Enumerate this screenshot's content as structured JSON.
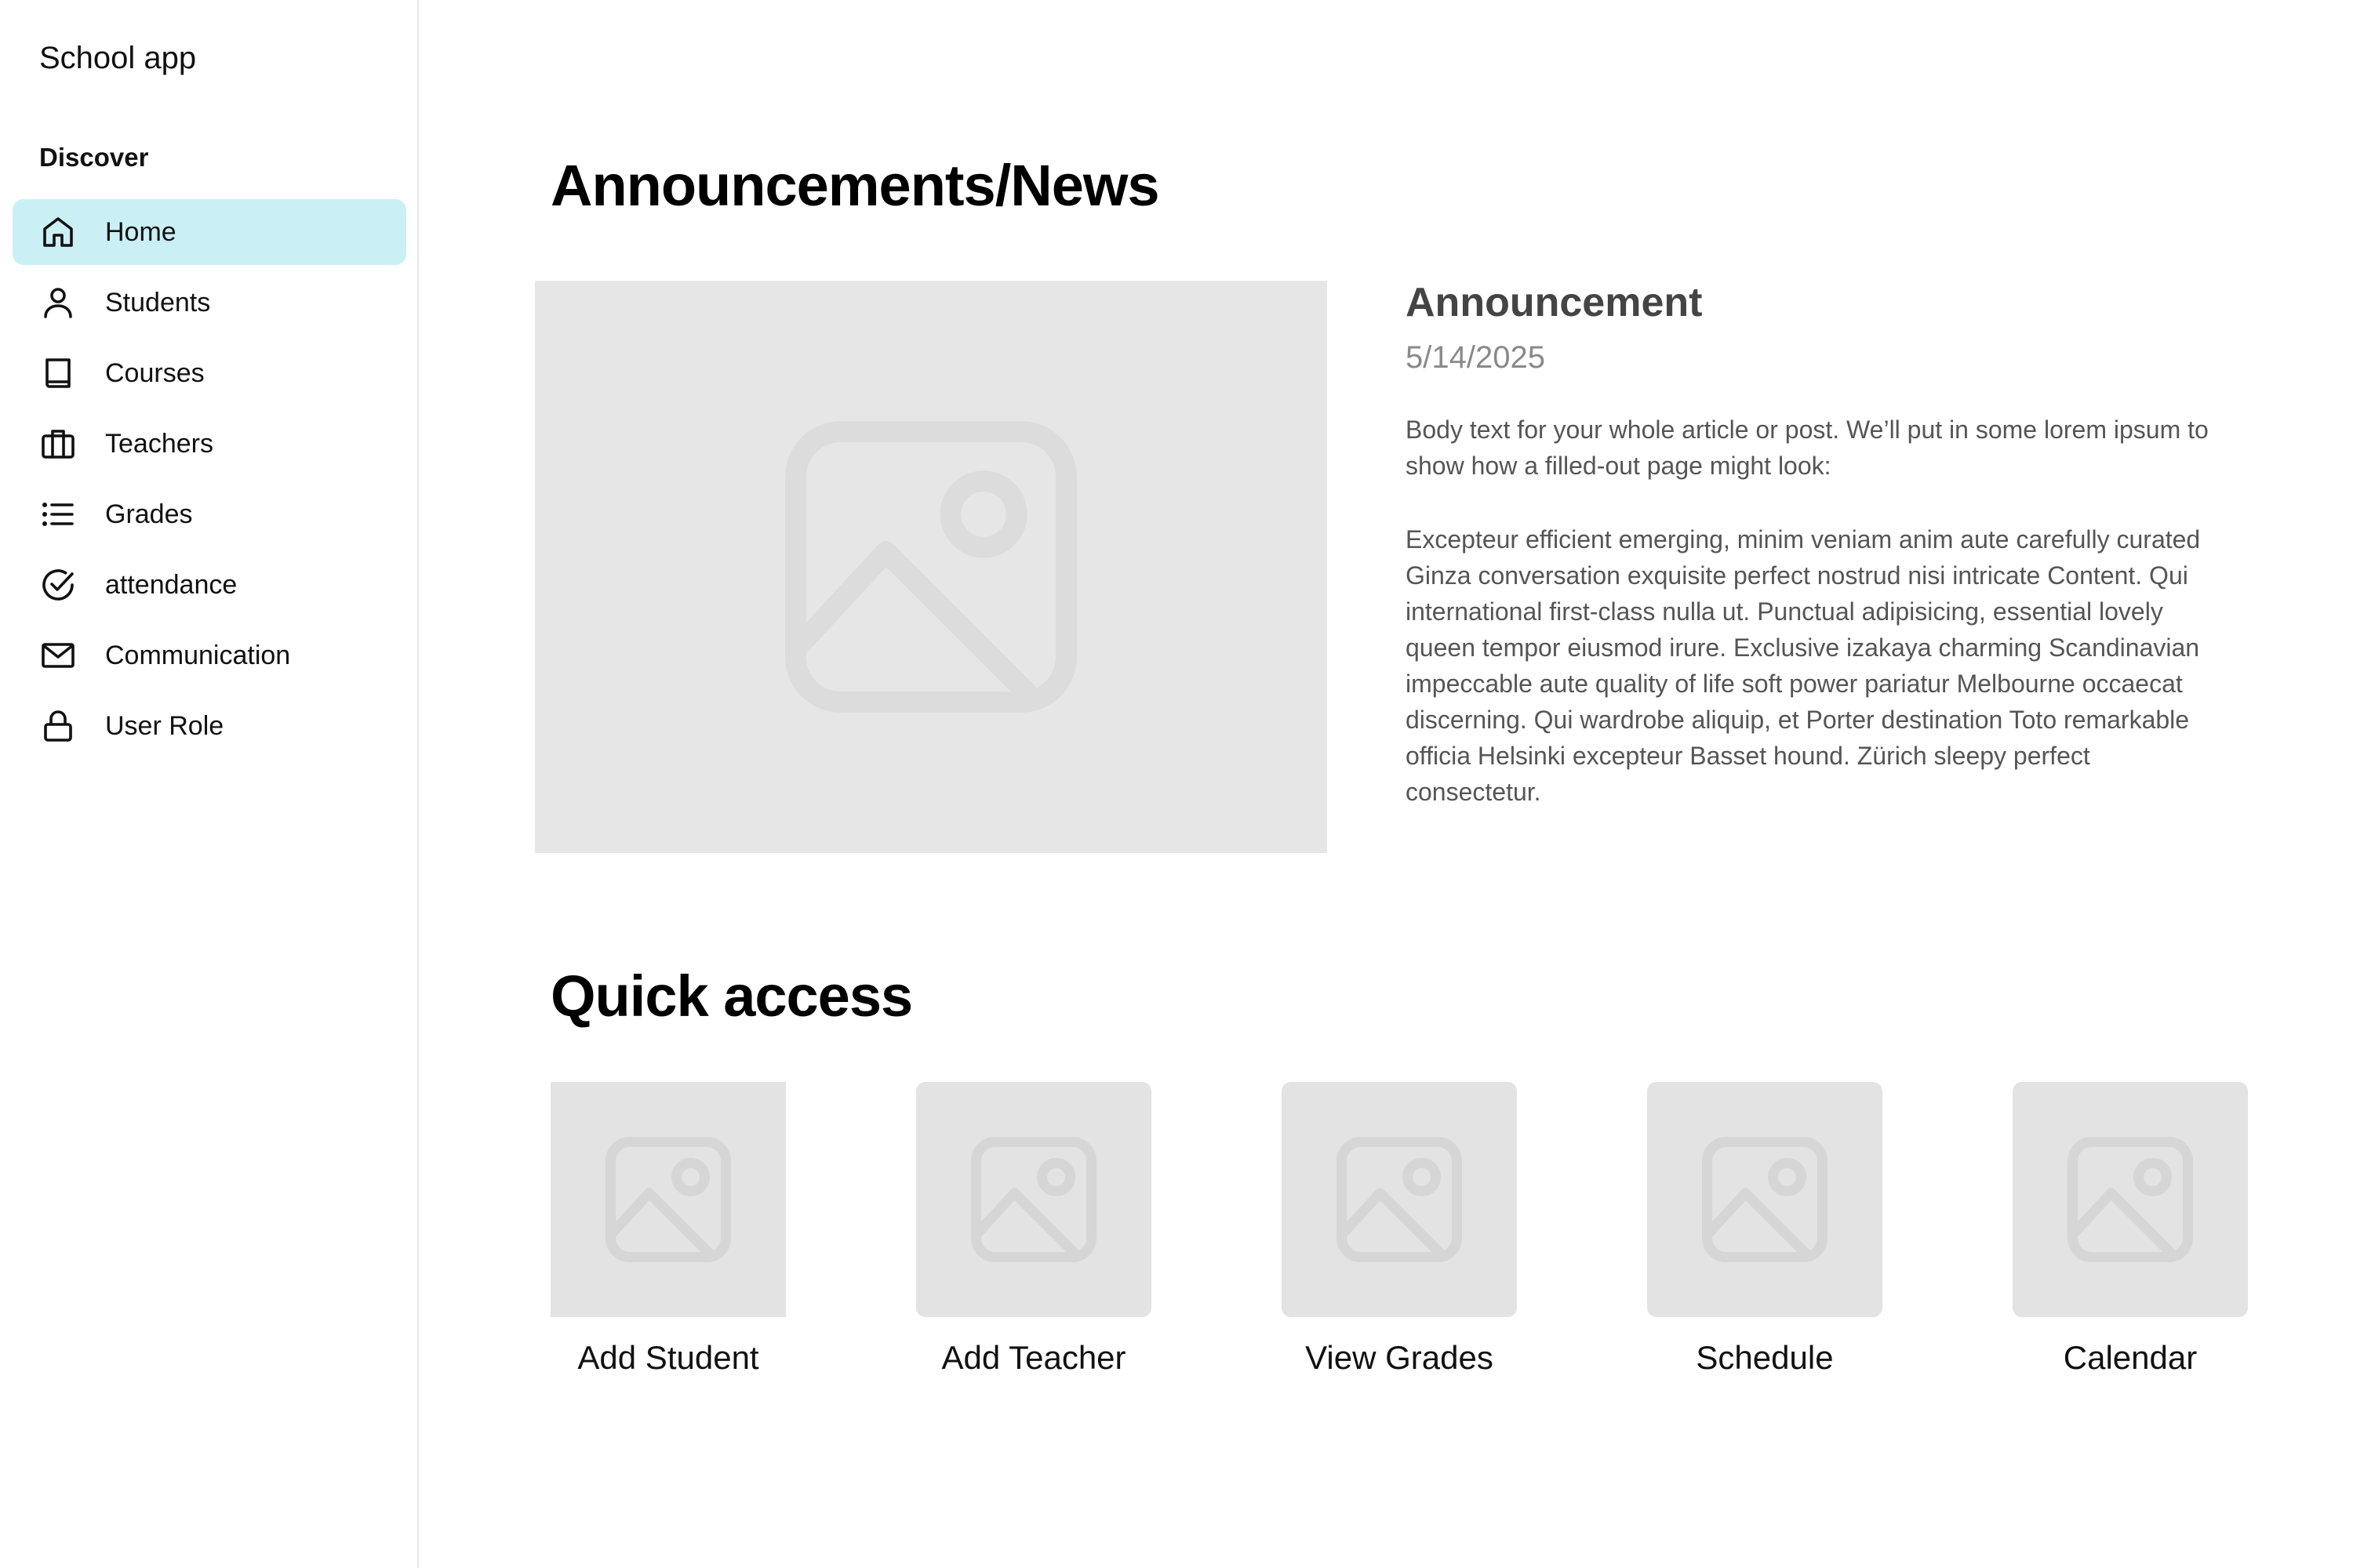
{
  "sidebar": {
    "app_title": "School app",
    "section_label": "Discover",
    "items": [
      {
        "label": "Home",
        "icon": "home-icon",
        "active": true
      },
      {
        "label": "Students",
        "icon": "user-icon",
        "active": false
      },
      {
        "label": "Courses",
        "icon": "book-icon",
        "active": false
      },
      {
        "label": "Teachers",
        "icon": "briefcase-icon",
        "active": false
      },
      {
        "label": "Grades",
        "icon": "list-icon",
        "active": false
      },
      {
        "label": "attendance",
        "icon": "check-circle-icon",
        "active": false
      },
      {
        "label": "Communication",
        "icon": "mail-icon",
        "active": false
      },
      {
        "label": "User Role",
        "icon": "lock-icon",
        "active": false
      }
    ]
  },
  "main": {
    "announcements_heading": "Announcements/News",
    "announcement": {
      "title": "Announcement",
      "date": "5/14/2025",
      "body_1": "Body text for your whole article or post. We’ll put in some lorem ipsum to show how a filled-out page might look:",
      "body_2": "Excepteur efficient emerging, minim veniam anim aute carefully curated Ginza conversation exquisite perfect nostrud nisi intricate Content. Qui  international first-class nulla ut. Punctual adipisicing, essential lovely queen tempor eiusmod irure. Exclusive izakaya charming Scandinavian impeccable aute quality of life soft power pariatur Melbourne occaecat discerning. Qui wardrobe aliquip, et Porter destination Toto remarkable officia Helsinki excepteur Basset hound. Zürich sleepy perfect consectetur."
    },
    "quick_access_heading": "Quick access",
    "quick_access": [
      {
        "label": "Add Student"
      },
      {
        "label": "Add Teacher"
      },
      {
        "label": "View Grades"
      },
      {
        "label": "Schedule"
      },
      {
        "label": "Calendar"
      }
    ]
  },
  "colors": {
    "active_nav_bg": "#caf0f6",
    "placeholder_bg": "#e6e6e6",
    "placeholder_icon": "#d9d9d9"
  }
}
